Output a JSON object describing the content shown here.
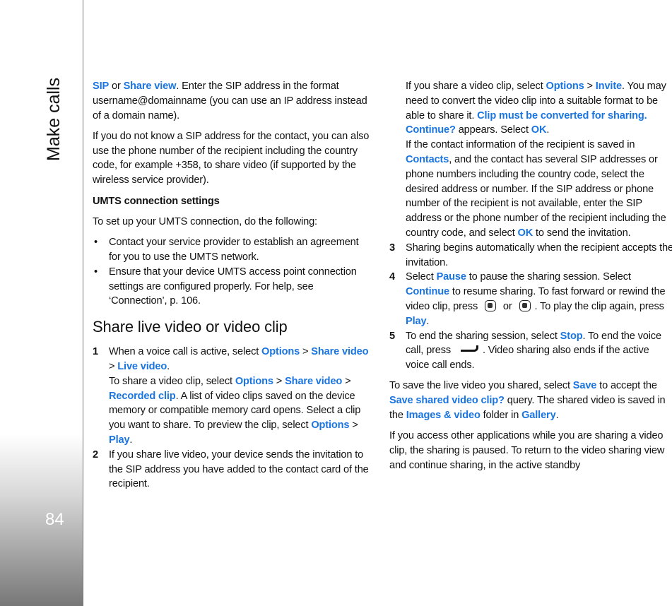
{
  "sidebar": {
    "chapter": "Make calls",
    "page_number": "84"
  },
  "colors": {
    "accent": "#1a75e0"
  },
  "left": [
    {
      "type": "p",
      "segs": [
        {
          "t": "SIP",
          "b": 1
        },
        {
          "t": " or "
        },
        {
          "t": "Share view",
          "b": 1
        },
        {
          "t": ". Enter the SIP address in the format username@domainname (you can use an IP address instead of a domain name)."
        }
      ]
    },
    {
      "type": "p",
      "segs": [
        {
          "t": "If you do not know a SIP address for the contact, you can also use the phone number of the recipient including the country code, for example +358, to share video (if supported by the wireless service provider)."
        }
      ]
    },
    {
      "type": "h3",
      "segs": [
        {
          "t": "UMTS connection settings"
        }
      ]
    },
    {
      "type": "p",
      "segs": [
        {
          "t": "To set up your UMTS connection, do the following:"
        }
      ]
    },
    {
      "type": "bul",
      "segs": [
        {
          "t": "Contact your service provider to establish an agreement for you to use the UMTS network."
        }
      ]
    },
    {
      "type": "bul",
      "last": 1,
      "segs": [
        {
          "t": "Ensure that your device UMTS access point connection settings are configured properly. For help, see ‘Connection’, p. 106."
        }
      ]
    },
    {
      "type": "h2",
      "segs": [
        {
          "t": "Share live video or video clip"
        }
      ]
    },
    {
      "type": "item",
      "n": "1",
      "segs": [
        {
          "t": "When a voice call is active, select "
        },
        {
          "t": "Options",
          "b": 1
        },
        {
          "t": " > "
        },
        {
          "t": "Share video",
          "b": 1
        },
        {
          "t": " > "
        },
        {
          "t": "Live video",
          "b": 1
        },
        {
          "t": "."
        }
      ]
    },
    {
      "type": "ind",
      "segs": [
        {
          "t": "To share a video clip, select "
        },
        {
          "t": "Options",
          "b": 1
        },
        {
          "t": " > "
        },
        {
          "t": "Share video",
          "b": 1
        },
        {
          "t": " > "
        },
        {
          "t": "Recorded clip",
          "b": 1
        },
        {
          "t": ". A list of video clips saved on the device memory or compatible memory card opens. Select a clip you want to share. To preview the clip, select "
        },
        {
          "t": "Options",
          "b": 1
        },
        {
          "t": " > "
        },
        {
          "t": "Play",
          "b": 1
        },
        {
          "t": "."
        }
      ]
    },
    {
      "type": "item",
      "n": "2",
      "segs": [
        {
          "t": "If you share live video, your device sends the invitation to the SIP address you have added to the contact card of the recipient."
        }
      ]
    }
  ],
  "right": [
    {
      "type": "ind",
      "segs": [
        {
          "t": "If you share a video clip, select "
        },
        {
          "t": "Options",
          "b": 1
        },
        {
          "t": " > "
        },
        {
          "t": "Invite",
          "b": 1
        },
        {
          "t": ". You may need to convert the video clip into a suitable format to be able to share it. "
        },
        {
          "t": "Clip must be converted for sharing. Continue?",
          "b": 1
        },
        {
          "t": " appears. Select "
        },
        {
          "t": "OK",
          "b": 1
        },
        {
          "t": "."
        }
      ]
    },
    {
      "type": "ind",
      "segs": [
        {
          "t": "If the contact information of the recipient is saved in "
        },
        {
          "t": "Contacts",
          "b": 1
        },
        {
          "t": ", and the contact has several SIP addresses or phone numbers including the country code, select the desired address or number. If the SIP address or phone number of the recipient is not available, enter the SIP address or the phone number of the recipient including the country code, and select "
        },
        {
          "t": "OK",
          "b": 1
        },
        {
          "t": " to send the invitation."
        }
      ]
    },
    {
      "type": "item",
      "n": "3",
      "segs": [
        {
          "t": "Sharing begins automatically when the recipient accepts the invitation."
        }
      ]
    },
    {
      "type": "item",
      "n": "4",
      "segs": [
        {
          "t": "Select "
        },
        {
          "t": "Pause",
          "b": 1
        },
        {
          "t": " to pause the sharing session. Select "
        },
        {
          "t": "Continue",
          "b": 1
        },
        {
          "t": " to resume sharing. To fast forward or rewind the video clip, press "
        },
        {
          "icon": "scroll-up-key-icon"
        },
        {
          "t": " or "
        },
        {
          "icon": "scroll-down-key-icon"
        },
        {
          "t": ". To play the clip again, press "
        },
        {
          "t": "Play",
          "b": 1
        },
        {
          "t": "."
        }
      ]
    },
    {
      "type": "item",
      "n": "5",
      "last": 1,
      "segs": [
        {
          "t": "To end the sharing session, select "
        },
        {
          "t": "Stop",
          "b": 1
        },
        {
          "t": ". To end the voice call, press "
        },
        {
          "icon": "end-key-icon"
        },
        {
          "t": ". Video sharing also ends if the active voice call ends."
        }
      ]
    },
    {
      "type": "p",
      "segs": [
        {
          "t": "To save the live video you shared, select "
        },
        {
          "t": "Save",
          "b": 1
        },
        {
          "t": " to accept the "
        },
        {
          "t": "Save shared video clip?",
          "b": 1
        },
        {
          "t": " query. The shared video is saved in the "
        },
        {
          "t": "Images & video",
          "b": 1
        },
        {
          "t": " folder in "
        },
        {
          "t": "Gallery",
          "b": 1
        },
        {
          "t": "."
        }
      ]
    },
    {
      "type": "p",
      "segs": [
        {
          "t": "If you access other applications while you are sharing a video clip, the sharing is paused. To return to the video sharing view and continue sharing, in the active standby"
        }
      ]
    }
  ]
}
